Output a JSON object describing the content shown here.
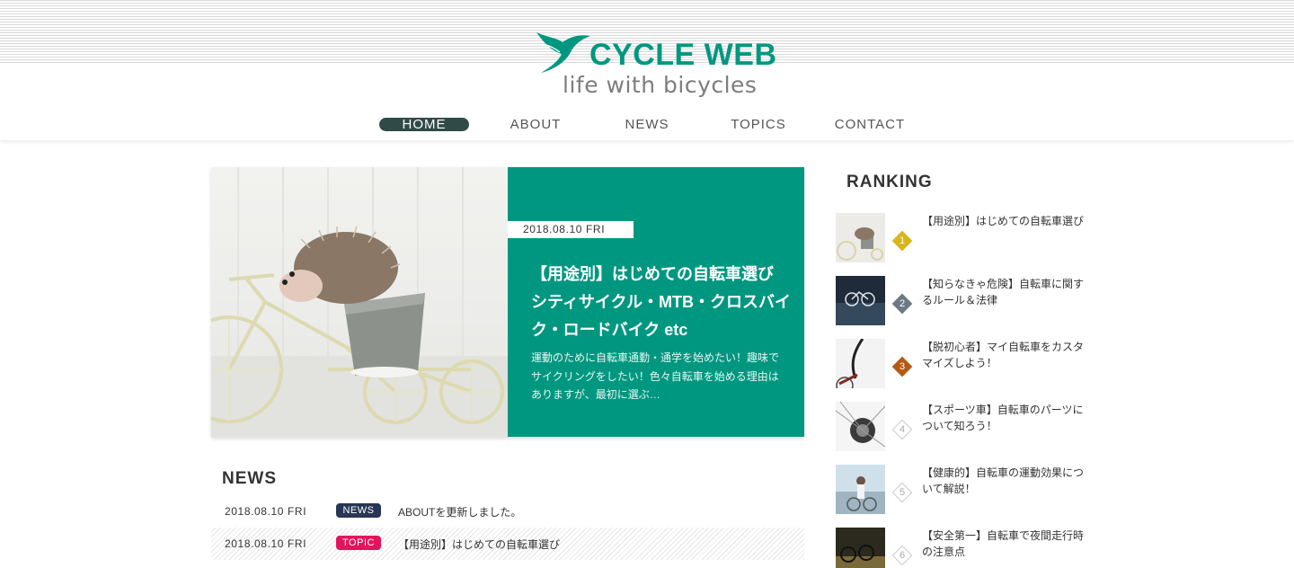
{
  "header": {
    "brand": "CYCLE WEB",
    "tagline": "life with bicycles",
    "brand_color": "#009780",
    "logo_icon": "swallow-bird-icon"
  },
  "nav": {
    "items": [
      {
        "label": "HOME",
        "active": true
      },
      {
        "label": "ABOUT",
        "active": false
      },
      {
        "label": "NEWS",
        "active": false
      },
      {
        "label": "TOPICS",
        "active": false
      },
      {
        "label": "CONTACT",
        "active": false
      }
    ],
    "active_color": "#2f4a47"
  },
  "hero": {
    "date": "2018.08.10 FRI",
    "title": "【用途別】はじめての自転車選び シティサイクル・MTB・クロスバイク・ロードバイク etc",
    "excerpt": "運動のために自転車通勤・通学を始めたい！趣味でサイクリングをしたい！色々自転車を始める理由はありますが、最初に選ぶ…",
    "image": "hedgehog-on-toy-bicycle"
  },
  "news": {
    "heading": "NEWS",
    "items": [
      {
        "date": "2018.08.10 FRI",
        "tag": "NEWS",
        "tag_color": "#283655",
        "title": "ABOUTを更新しました。"
      },
      {
        "date": "2018.08.10 FRI",
        "tag": "TOPIC",
        "tag_color": "#e4145c",
        "title": "【用途別】はじめての自転車選び"
      }
    ]
  },
  "ranking": {
    "heading": "RANKING",
    "items": [
      {
        "rank": "1",
        "title": "【用途別】はじめての自転車選び",
        "badge_color": "#d8b51a",
        "image": "hedgehog-thumb"
      },
      {
        "rank": "2",
        "title": "【知らなきゃ危険】自転車に関するルール＆法律",
        "badge_color": "#6e7887",
        "image": "bike-lane-sign-thumb"
      },
      {
        "rank": "3",
        "title": "【脱初心者】マイ自転車をカスタマイズしよう！",
        "badge_color": "#b55a12",
        "image": "road-bike-handlebar-thumb"
      },
      {
        "rank": "4",
        "title": "【スポーツ車】自転車のパーツについて知ろう！",
        "badge_color": "#ffffff",
        "image": "bike-gear-thumb"
      },
      {
        "rank": "5",
        "title": "【健康的】自転車の運動効果について解説！",
        "badge_color": "#ffffff",
        "image": "seaside-cyclist-thumb"
      },
      {
        "rank": "6",
        "title": "【安全第一】自転車で夜間走行時の注意点",
        "badge_color": "#ffffff",
        "image": "night-bicycles-thumb"
      }
    ]
  }
}
